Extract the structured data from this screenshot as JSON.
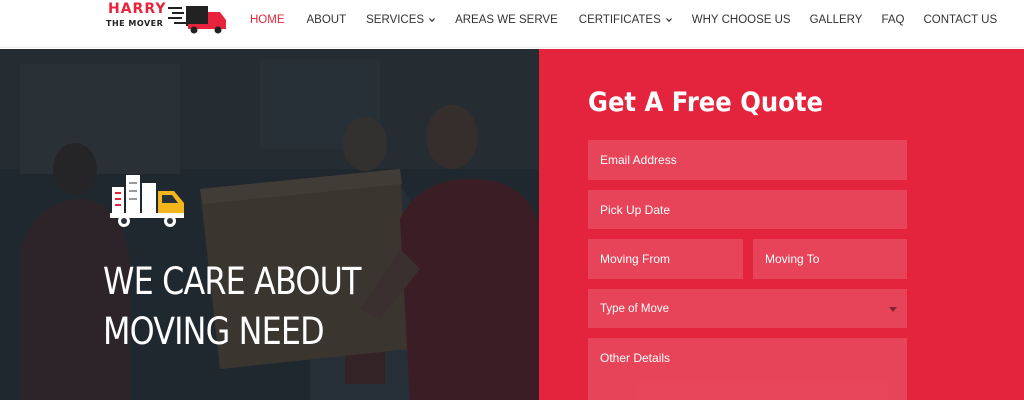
{
  "logo": {
    "line1": "HARRY",
    "line2": "THE MOVER"
  },
  "nav": {
    "items": [
      {
        "label": "HOME",
        "active": true,
        "dropdown": false
      },
      {
        "label": "ABOUT",
        "active": false,
        "dropdown": false
      },
      {
        "label": "SERVICES",
        "active": false,
        "dropdown": true
      },
      {
        "label": "AREAS WE SERVE",
        "active": false,
        "dropdown": false
      },
      {
        "label": "CERTIFICATES",
        "active": false,
        "dropdown": true
      },
      {
        "label": "WHY CHOOSE US",
        "active": false,
        "dropdown": false
      },
      {
        "label": "GALLERY",
        "active": false,
        "dropdown": false
      },
      {
        "label": "FAQ",
        "active": false,
        "dropdown": false
      },
      {
        "label": "CONTACT US",
        "active": false,
        "dropdown": false
      }
    ]
  },
  "hero": {
    "title_line1": "WE CARE ABOUT",
    "title_line2": "MOVING NEED",
    "icon": "moving-truck-icon"
  },
  "quote": {
    "title": "Get A Free Quote",
    "fields": {
      "email": "Email Address",
      "pickup_date": "Pick Up Date",
      "moving_from": "Moving From",
      "moving_to": "Moving To",
      "type_of_move": "Type of Move",
      "other_details": "Other Details"
    }
  },
  "colors": {
    "accent": "#e3243c",
    "nav_text": "#333333",
    "hero_overlay": "#1e2830"
  }
}
